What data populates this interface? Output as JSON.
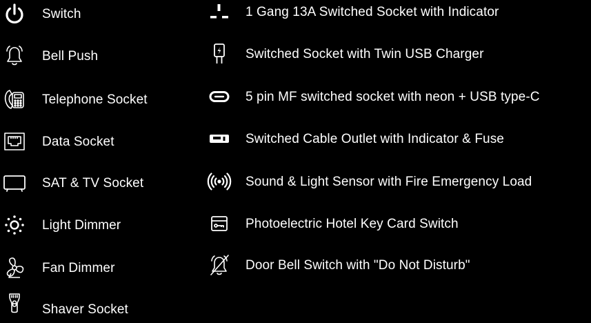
{
  "legend": {
    "left_items": [
      {
        "icon": "power-icon",
        "label": "Switch"
      },
      {
        "icon": "bell-icon",
        "label": "Bell Push"
      },
      {
        "icon": "telephone-icon",
        "label": "Telephone Socket"
      },
      {
        "icon": "ethernet-port-icon",
        "label": "Data Socket"
      },
      {
        "icon": "tv-icon",
        "label": "SAT & TV Socket"
      },
      {
        "icon": "light-dimmer-icon",
        "label": "Light Dimmer"
      },
      {
        "icon": "fan-icon",
        "label": "Fan Dimmer"
      },
      {
        "icon": "shaver-icon",
        "label": "Shaver Socket"
      }
    ],
    "right_items": [
      {
        "icon": "socket-pins-icon",
        "label": "1 Gang 13A Switched Socket with Indicator"
      },
      {
        "icon": "usb-charger-plug-icon",
        "label": "Switched Socket with Twin USB Charger"
      },
      {
        "icon": "usb-type-c-icon",
        "label": "5 pin MF switched socket with neon + USB type-C"
      },
      {
        "icon": "cable-outlet-icon",
        "label": "Switched Cable Outlet with Indicator & Fuse"
      },
      {
        "icon": "sound-sensor-icon",
        "label": "Sound & Light Sensor with Fire Emergency Load"
      },
      {
        "icon": "key-card-icon",
        "label": "Photoelectric Hotel Key Card Switch"
      },
      {
        "icon": "bell-slash-icon",
        "label": "Door Bell Switch with \"Do Not Disturb\""
      }
    ]
  },
  "colors": {
    "background": "#000000",
    "foreground": "#ffffff"
  }
}
